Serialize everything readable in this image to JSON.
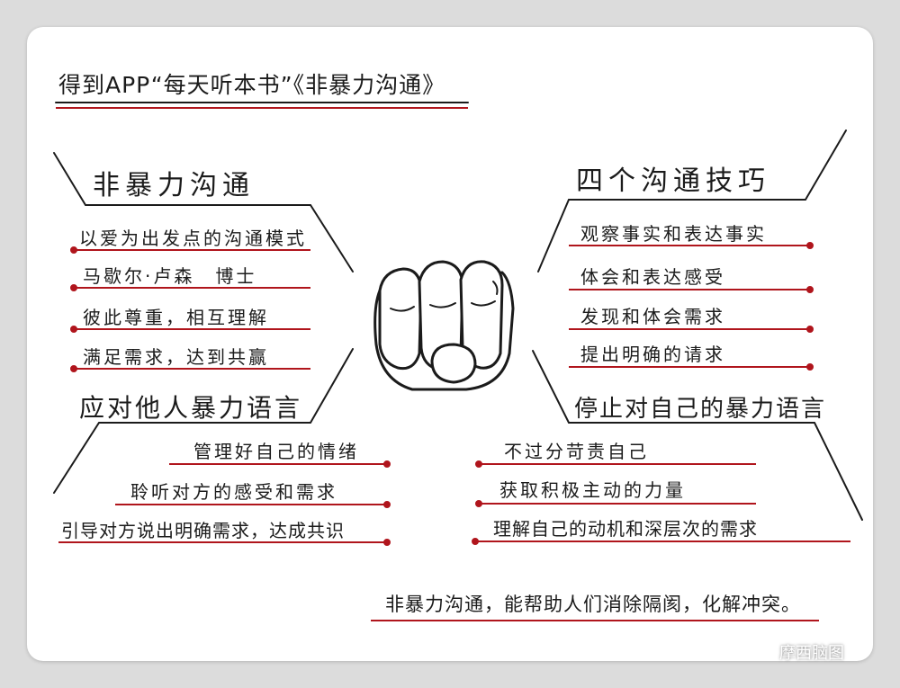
{
  "header": "得到APP“每天听本书”《非暴力沟通》",
  "sections": {
    "nvc": {
      "title": "非暴力沟通",
      "items": [
        "以爱为出发点的沟通模式",
        "马歇尔·卢森　博士",
        "彼此尊重，相互理解",
        "满足需求，达到共赢"
      ]
    },
    "skills": {
      "title": "四个沟通技巧",
      "items": [
        "观察事实和表达事实",
        "体会和表达感受",
        "发现和体会需求",
        "提出明确的请求"
      ]
    },
    "others": {
      "title": "应对他人暴力语言",
      "items": [
        "管理好自己的情绪",
        "聆听对方的感受和需求",
        "引导对方说出明确需求，达成共识"
      ]
    },
    "self": {
      "title": "停止对自己的暴力语言",
      "items": [
        "不过分苛责自己",
        "获取积极主动的力量",
        "理解自己的动机和深层次的需求"
      ]
    }
  },
  "conclusion": "非暴力沟通，能帮助人们消除隔阂，化解冲突。",
  "watermark": "摩西脑图",
  "colors": {
    "ink": "#1b1b1b",
    "accent": "#b0151c",
    "card": "#ffffff",
    "background": "#dcdcdc"
  },
  "icons": {
    "center": "fist-icon",
    "watermark": "wechat-icon"
  }
}
